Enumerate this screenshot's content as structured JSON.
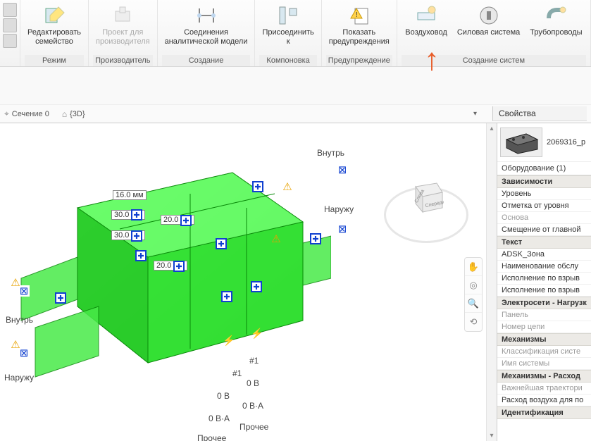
{
  "ribbon": {
    "groups": [
      {
        "label": "Режим",
        "buttons": [
          {
            "name": "edit-family",
            "l1": "Редактировать",
            "l2": "семейство"
          }
        ]
      },
      {
        "label": "Производитель",
        "buttons": [
          {
            "name": "manufacturer-project",
            "l1": "Проект для",
            "l2": "производителя",
            "disabled": true
          }
        ]
      },
      {
        "label": "Создание",
        "buttons": [
          {
            "name": "analytical-connections",
            "l1": "Соединения",
            "l2": "аналитической модели"
          }
        ]
      },
      {
        "label": "Компоновка",
        "buttons": [
          {
            "name": "attach-to",
            "l1": "Присоединить",
            "l2": "к"
          }
        ]
      },
      {
        "label": "Предупреждение",
        "buttons": [
          {
            "name": "show-warnings",
            "l1": "Показать",
            "l2": "предупреждения"
          }
        ]
      },
      {
        "label": "Создание систем",
        "buttons": [
          {
            "name": "duct-system",
            "l1": "Воздуховод",
            "l2": ""
          },
          {
            "name": "power-system",
            "l1": "Силовая система",
            "l2": ""
          },
          {
            "name": "pipe-system",
            "l1": "Трубопроводы",
            "l2": ""
          }
        ]
      }
    ]
  },
  "viewTabs": {
    "section": "Сечение 0",
    "view3d": "{3D}"
  },
  "viewport": {
    "labels": {
      "inside": "Внутрь",
      "outside": "Наружу"
    },
    "dims": {
      "d1": "16.0 мм",
      "d2": "30.0 мм",
      "d3": "30.0 мм",
      "d4": "20.0 мм",
      "d5": "20.0 мм"
    },
    "electrical": {
      "circuit": "#1",
      "voltage": "0 В",
      "va": "0 В·А",
      "other": "Прочее"
    },
    "cube": {
      "left": "Слева",
      "front": "Спереди"
    }
  },
  "properties": {
    "title": "Свойства",
    "familyType": "2069316_р",
    "typeRow": "Оборудование (1)",
    "sections": [
      {
        "head": "Зависимости",
        "rows": [
          {
            "t": "Уровень"
          },
          {
            "t": "Отметка от уровня"
          },
          {
            "t": "Основа",
            "dim": true
          },
          {
            "t": "Смещение от главной"
          }
        ]
      },
      {
        "head": "Текст",
        "rows": [
          {
            "t": "ADSK_Зона"
          },
          {
            "t": "Наименование обслу"
          },
          {
            "t": "Исполнение по взрыв"
          },
          {
            "t": "Исполнение по взрыв"
          }
        ]
      },
      {
        "head": "Электросети - Нагрузк",
        "rows": [
          {
            "t": "Панель",
            "dim": true
          },
          {
            "t": "Номер цепи",
            "dim": true
          }
        ]
      },
      {
        "head": "Механизмы",
        "rows": [
          {
            "t": "Классификация систе",
            "dim": true
          },
          {
            "t": "Имя системы",
            "dim": true
          }
        ]
      },
      {
        "head": "Механизмы - Расход",
        "rows": [
          {
            "t": "Важнейшая траектори",
            "dim": true
          },
          {
            "t": "Расход воздуха для по"
          }
        ]
      },
      {
        "head": "Идентификация",
        "rows": []
      }
    ]
  }
}
